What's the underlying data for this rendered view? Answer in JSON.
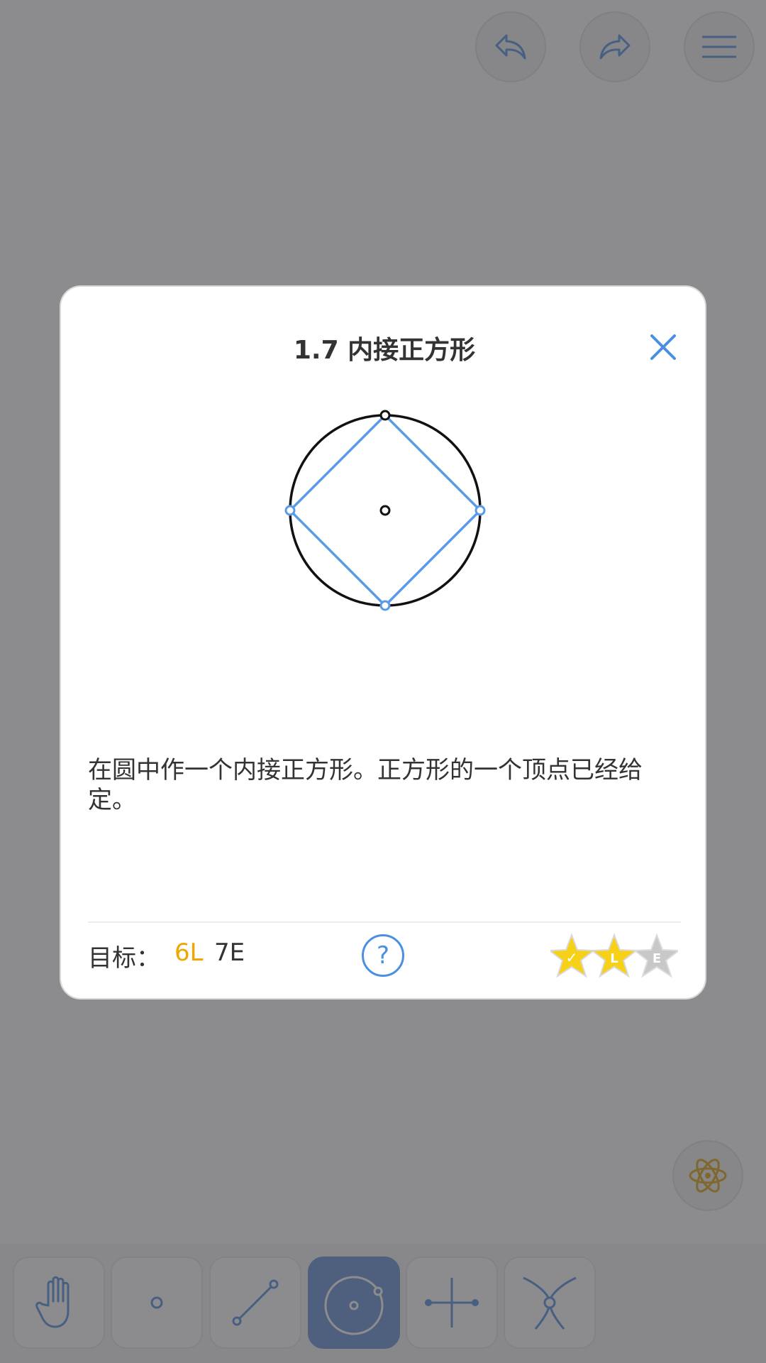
{
  "header": {
    "undo_icon": "undo-icon",
    "redo_icon": "redo-icon",
    "menu_icon": "menu-icon"
  },
  "dialog": {
    "title": "1.7 内接正方形",
    "close_icon": "close-icon",
    "description": "在圆中作一个内接正方形。正方形的一个顶点已经给定。",
    "goal": {
      "label": "目标：",
      "l_value": "6L",
      "e_value": "7E"
    },
    "help_label": "?",
    "stars": [
      {
        "mark": "✓",
        "state": "earned",
        "color": "#f7d117"
      },
      {
        "mark": "L",
        "state": "earned",
        "color": "#f7d117"
      },
      {
        "mark": "E",
        "state": "not-earned",
        "color": "#c8c8c8"
      }
    ]
  },
  "hint_button": {
    "icon": "atom-icon",
    "color": "#d9a400"
  },
  "toolbar": {
    "tools": [
      {
        "name": "move",
        "icon": "hand-icon",
        "active": false
      },
      {
        "name": "point",
        "icon": "point-icon",
        "active": false
      },
      {
        "name": "line",
        "icon": "line-icon",
        "active": false
      },
      {
        "name": "circle",
        "icon": "circle-icon",
        "active": true
      },
      {
        "name": "perpendicular-bisector",
        "icon": "perpendicular-bisector-icon",
        "active": false
      },
      {
        "name": "intersect",
        "icon": "intersection-icon",
        "active": false
      }
    ]
  },
  "colors": {
    "accent": "#4a8fe0",
    "gold": "#f0a500",
    "overlay": "#464448"
  }
}
